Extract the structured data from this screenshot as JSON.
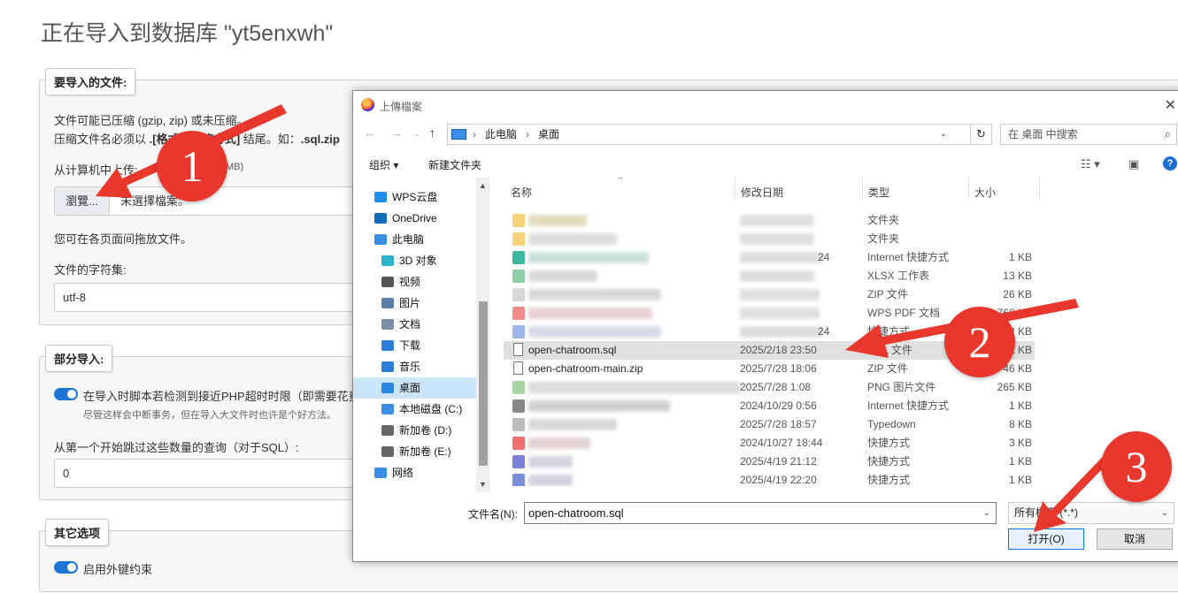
{
  "page": {
    "title": "正在导入到数据库 \"yt5enxwh\"",
    "import_file": {
      "legend": "要导入的文件:",
      "line1": "文件可能已压缩 (gzip, zip) 或未压缩。",
      "line2_pre": "压缩文件名必须以 ",
      "line2_mid": ".[格式].[压缩方式]",
      "line2_post": " 结尾。如：",
      "line2_ext": ".sql.zip",
      "upload_label": "从计算机中上传:",
      "max_size": "MB)",
      "browse_button": "瀏覽...",
      "no_file": "未選擇檔案。",
      "drag_hint": "您可在各页面间拖放文件。",
      "charset_label": "文件的字符集:",
      "charset_value": "utf-8"
    },
    "partial_import": {
      "legend": "部分导入:",
      "timeout_option": "在导入时脚本若检测到接近PHP超时时限（即需要花费",
      "timeout_hint": "尽管这样会中断事务，但在导入大文件时也许是个好方法。",
      "skip_label": "从第一个开始跳过这些数量的查询（对于SQL）:",
      "skip_value": "0"
    },
    "other_options": {
      "legend": "其它选项",
      "fk_option": "启用外键约束"
    }
  },
  "dialog": {
    "title": "上傳檔案",
    "close": "✕",
    "breadcrumb": [
      "此电脑",
      "桌面"
    ],
    "search_placeholder": "在 桌面 中搜索",
    "organize": "组织 ▾",
    "new_folder": "新建文件夹",
    "nav": [
      {
        "label": "WPS云盘",
        "color": "#1f8ef1"
      },
      {
        "label": "OneDrive",
        "color": "#0f6cbd"
      },
      {
        "label": "此电脑",
        "color": "#3a8ee6"
      },
      {
        "label": "3D 对象",
        "color": "#2bb3c9"
      },
      {
        "label": "视频",
        "color": "#555555"
      },
      {
        "label": "图片",
        "color": "#5a7fa8"
      },
      {
        "label": "文档",
        "color": "#7a8ea8"
      },
      {
        "label": "下载",
        "color": "#2b7fd6"
      },
      {
        "label": "音乐",
        "color": "#2b7fd6"
      },
      {
        "label": "桌面",
        "color": "#2b86e0"
      },
      {
        "label": "本地磁盘 (C:)",
        "color": "#3a8ee6"
      },
      {
        "label": "新加卷 (D:)",
        "color": "#666666"
      },
      {
        "label": "新加卷 (E:)",
        "color": "#666666"
      },
      {
        "label": "网络",
        "color": "#3a8ee6"
      }
    ],
    "columns": {
      "name": "名称",
      "date": "修改日期",
      "type": "类型",
      "size": "大小"
    },
    "files": [
      {
        "name": "",
        "date": "",
        "type": "文件夹",
        "size": "",
        "icon": "#f5d27a",
        "blur": "#d8cfa8"
      },
      {
        "name": "",
        "date": "",
        "type": "文件夹",
        "size": "",
        "icon": "#f5d27a",
        "blur": "#d0d0d0"
      },
      {
        "name": "",
        "date": "24",
        "type": "Internet 快捷方式",
        "size": "1 KB",
        "icon": "#3fb7a0",
        "blur": "#b9d6cf"
      },
      {
        "name": "",
        "date": "",
        "type": "XLSX 工作表",
        "size": "13 KB",
        "icon": "#8fcfa8",
        "blur": "#cccccc"
      },
      {
        "name": "",
        "date": "",
        "type": "ZIP 文件",
        "size": "26 KB",
        "icon": "#d7d7d7",
        "blur": "#cccccc"
      },
      {
        "name": "",
        "date": "",
        "type": "WPS PDF 文档",
        "size": "768 KB",
        "icon": "#f08a8a",
        "blur": "#dcc2c2"
      },
      {
        "name": "",
        "date": "24",
        "type": "快捷方式",
        "size": "2 KB",
        "icon": "#9fb6e8",
        "blur": "#c8cfe0"
      },
      {
        "name": "open-chatroom.sql",
        "date": "2025/2/18 23:50",
        "type": "SQL 文件",
        "size": "1 KB",
        "icon": "",
        "blur": ""
      },
      {
        "name": "open-chatroom-main.zip",
        "date": "2025/7/28 18:06",
        "type": "ZIP 文件",
        "size": "46 KB",
        "icon": "",
        "blur": ""
      },
      {
        "name": "",
        "date": "2025/7/28 1:08",
        "type": "PNG 图片文件",
        "size": "265 KB",
        "icon": "#a9d3a0",
        "blur": "#cfcfcf"
      },
      {
        "name": "",
        "date": "2024/10/29 0:56",
        "type": "Internet 快捷方式",
        "size": "1 KB",
        "icon": "#888888",
        "blur": "#c4c4c4"
      },
      {
        "name": "",
        "date": "2025/7/28 18:57",
        "type": "Typedown",
        "size": "8 KB",
        "icon": "#bbbbbb",
        "blur": "#cccccc"
      },
      {
        "name": "",
        "date": "2024/10/27 18:44",
        "type": "快捷方式",
        "size": "3 KB",
        "icon": "#f07070",
        "blur": "#d8c4c4"
      },
      {
        "name": "",
        "date": "2025/4/19 21:12",
        "type": "快捷方式",
        "size": "1 KB",
        "icon": "#7a7fd8",
        "blur": "#c6c6d6"
      },
      {
        "name": "",
        "date": "2025/4/19 22:20",
        "type": "快捷方式",
        "size": "1 KB",
        "icon": "#7a8fd8",
        "blur": "#c6c6d6"
      }
    ],
    "filename_label": "文件名(N):",
    "filename_value": "open-chatroom.sql",
    "filter_value": "所有檔案 (*.*)",
    "open_button": "打开(O)",
    "cancel_button": "取消"
  },
  "annotations": {
    "badges": [
      "1",
      "2",
      "3"
    ],
    "color": "#e8382e"
  }
}
